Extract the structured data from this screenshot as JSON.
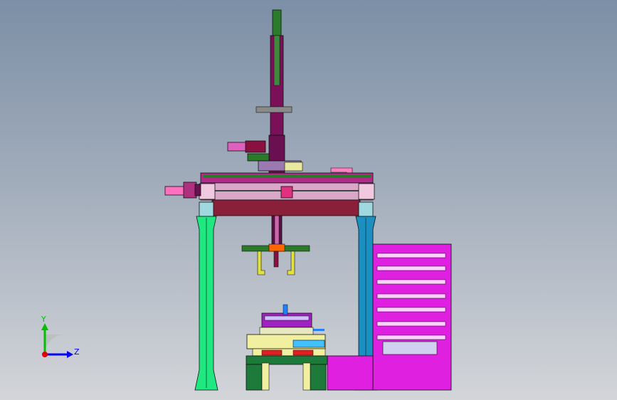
{
  "triad": {
    "y_label": "Y",
    "z_label": "Z",
    "colors": {
      "y": "#00c000",
      "z": "#0000ff",
      "origin": "#e00000"
    }
  },
  "model": {
    "colors": {
      "frame_left": "#20e880",
      "frame_right": "#1a8fc0",
      "beam": "#8a1f3a",
      "rail": "#d9a7c7",
      "column": "#6a1050",
      "column_core": "#2a7a2a",
      "cabinet": "#e020e0",
      "drawer": "#ffd0ff",
      "table_base": "#1e7a3a",
      "table_top": "#f0f0a0",
      "fixture": "#a020c0",
      "gripper": "#e0e040"
    }
  }
}
